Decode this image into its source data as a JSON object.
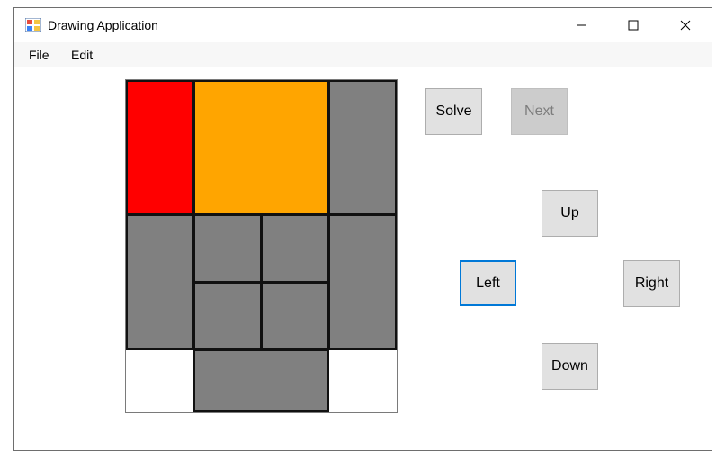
{
  "window": {
    "title": "Drawing Application",
    "icon": "app-window-icon"
  },
  "menu": {
    "file": "File",
    "edit": "Edit"
  },
  "buttons": {
    "solve": "Solve",
    "next": "Next",
    "up": "Up",
    "left": "Left",
    "right": "Right",
    "down": "Down"
  },
  "puzzle": {
    "colors": {
      "target": "#ff0000",
      "large": "#ffa500",
      "block": "#808080",
      "empty": "#ffffff"
    }
  }
}
